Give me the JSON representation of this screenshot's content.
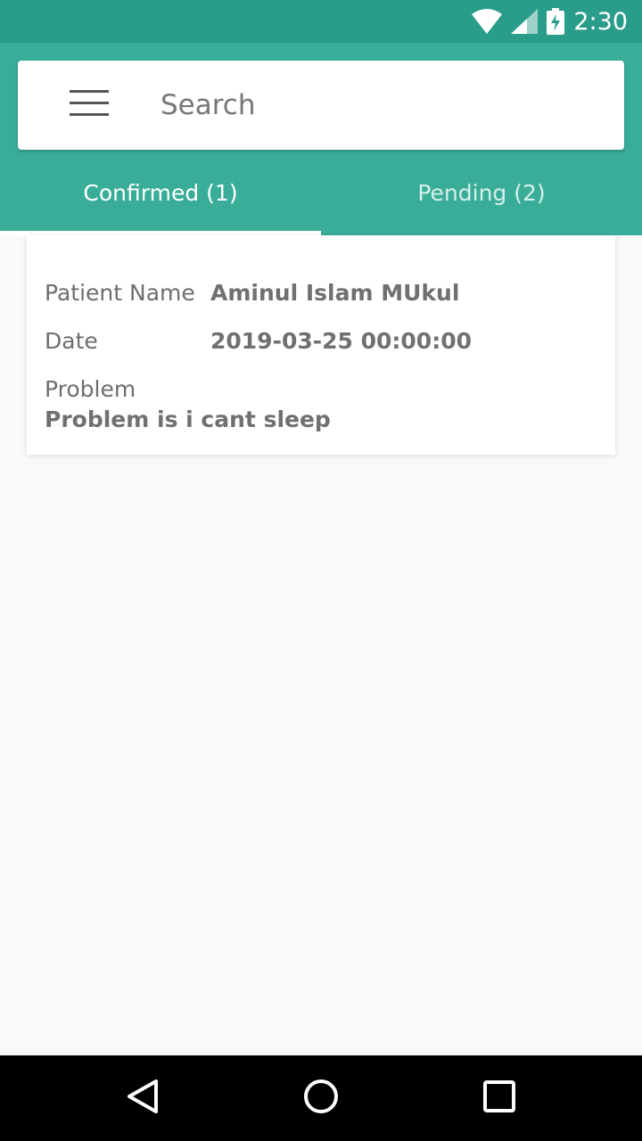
{
  "status_bar": {
    "time": "2:30",
    "icons": [
      "wifi-icon",
      "signal-icon",
      "battery-charging-icon"
    ]
  },
  "colors": {
    "status_bar": "#2a9d8a",
    "app_bar": "#3aad98",
    "background": "#f9f9f9"
  },
  "search": {
    "placeholder": "Search",
    "menu_icon": "hamburger-menu-icon"
  },
  "tabs": [
    {
      "label": "Confirmed (1)",
      "active": true
    },
    {
      "label": "Pending (2)",
      "active": false
    }
  ],
  "appointments": [
    {
      "patient_name_label": "Patient Name",
      "patient_name": "Aminul Islam MUkul",
      "date_label": "Date",
      "date": "2019-03-25 00:00:00",
      "problem_label": "Problem",
      "problem": "Problem is i cant sleep"
    }
  ],
  "nav": {
    "back": "back-triangle-icon",
    "home": "home-circle-icon",
    "recents": "recents-square-icon"
  }
}
